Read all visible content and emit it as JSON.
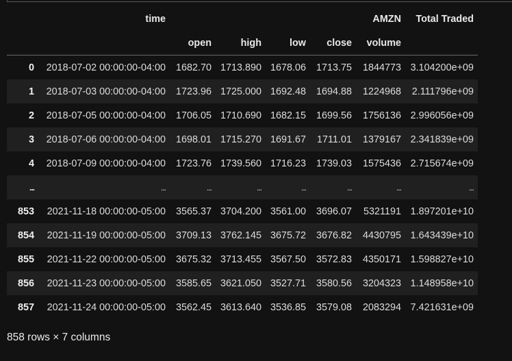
{
  "dataframe": {
    "header_level1": {
      "time": "time",
      "ticker": "AMZN",
      "total_traded": "Total Traded"
    },
    "header_level2": [
      "open",
      "high",
      "low",
      "close",
      "volume"
    ],
    "rows": [
      {
        "index": "0",
        "time": "2018-07-02 00:00:00-04:00",
        "open": "1682.70",
        "high": "1713.890",
        "low": "1678.06",
        "close": "1713.75",
        "volume": "1844773",
        "total_traded": "3.104200e+09"
      },
      {
        "index": "1",
        "time": "2018-07-03 00:00:00-04:00",
        "open": "1723.96",
        "high": "1725.000",
        "low": "1692.48",
        "close": "1694.88",
        "volume": "1224968",
        "total_traded": "2.111796e+09"
      },
      {
        "index": "2",
        "time": "2018-07-05 00:00:00-04:00",
        "open": "1706.05",
        "high": "1710.690",
        "low": "1682.15",
        "close": "1699.56",
        "volume": "1756136",
        "total_traded": "2.996056e+09"
      },
      {
        "index": "3",
        "time": "2018-07-06 00:00:00-04:00",
        "open": "1698.01",
        "high": "1715.270",
        "low": "1691.67",
        "close": "1711.01",
        "volume": "1379167",
        "total_traded": "2.341839e+09"
      },
      {
        "index": "4",
        "time": "2018-07-09 00:00:00-04:00",
        "open": "1723.76",
        "high": "1739.560",
        "low": "1716.23",
        "close": "1739.03",
        "volume": "1575436",
        "total_traded": "2.715674e+09"
      },
      {
        "index": "...",
        "time": "...",
        "open": "...",
        "high": "...",
        "low": "...",
        "close": "...",
        "volume": "...",
        "total_traded": "..."
      },
      {
        "index": "853",
        "time": "2021-11-18 00:00:00-05:00",
        "open": "3565.37",
        "high": "3704.200",
        "low": "3561.00",
        "close": "3696.07",
        "volume": "5321191",
        "total_traded": "1.897201e+10"
      },
      {
        "index": "854",
        "time": "2021-11-19 00:00:00-05:00",
        "open": "3709.13",
        "high": "3762.145",
        "low": "3675.72",
        "close": "3676.82",
        "volume": "4430795",
        "total_traded": "1.643439e+10"
      },
      {
        "index": "855",
        "time": "2021-11-22 00:00:00-05:00",
        "open": "3675.32",
        "high": "3713.455",
        "low": "3567.50",
        "close": "3572.83",
        "volume": "4350171",
        "total_traded": "1.598827e+10"
      },
      {
        "index": "856",
        "time": "2021-11-23 00:00:00-05:00",
        "open": "3585.65",
        "high": "3621.050",
        "low": "3527.71",
        "close": "3580.56",
        "volume": "3204323",
        "total_traded": "1.148958e+10"
      },
      {
        "index": "857",
        "time": "2021-11-24 00:00:00-05:00",
        "open": "3562.45",
        "high": "3613.640",
        "low": "3536.85",
        "close": "3579.08",
        "volume": "2083294",
        "total_traded": "7.421631e+09"
      }
    ],
    "footer": "858 rows × 7 columns"
  }
}
